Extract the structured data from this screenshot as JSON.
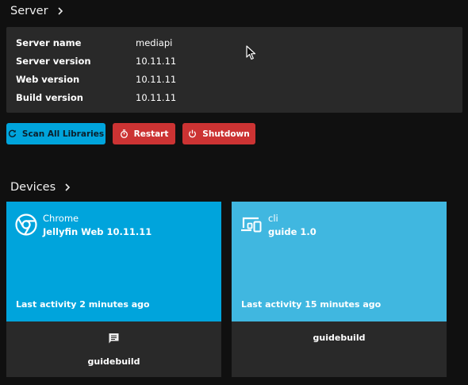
{
  "server": {
    "title": "Server",
    "rows": [
      {
        "label": "Server name",
        "value": "mediapi"
      },
      {
        "label": "Server version",
        "value": "10.11.11"
      },
      {
        "label": "Web version",
        "value": "10.11.11"
      },
      {
        "label": "Build version",
        "value": "10.11.11"
      }
    ]
  },
  "actions": {
    "scan_label": "Scan All Libraries",
    "restart_label": "Restart",
    "shutdown_label": "Shutdown"
  },
  "devices": {
    "title": "Devices",
    "items": [
      {
        "name": "Chrome",
        "app": "Jellyfin Web 10.11.11",
        "activity": "Last activity 2 minutes ago",
        "user": "guidebuild",
        "icon": "chrome-icon",
        "color": "#00a4dc"
      },
      {
        "name": "cli",
        "app": "guide 1.0",
        "activity": "Last activity 15 minutes ago",
        "user": "guidebuild",
        "icon": "devices-icon",
        "color": "#40b7e0"
      }
    ]
  },
  "colors": {
    "background": "#101010",
    "panel": "#292929",
    "accent": "#00a4dc",
    "danger": "#cc3333"
  }
}
